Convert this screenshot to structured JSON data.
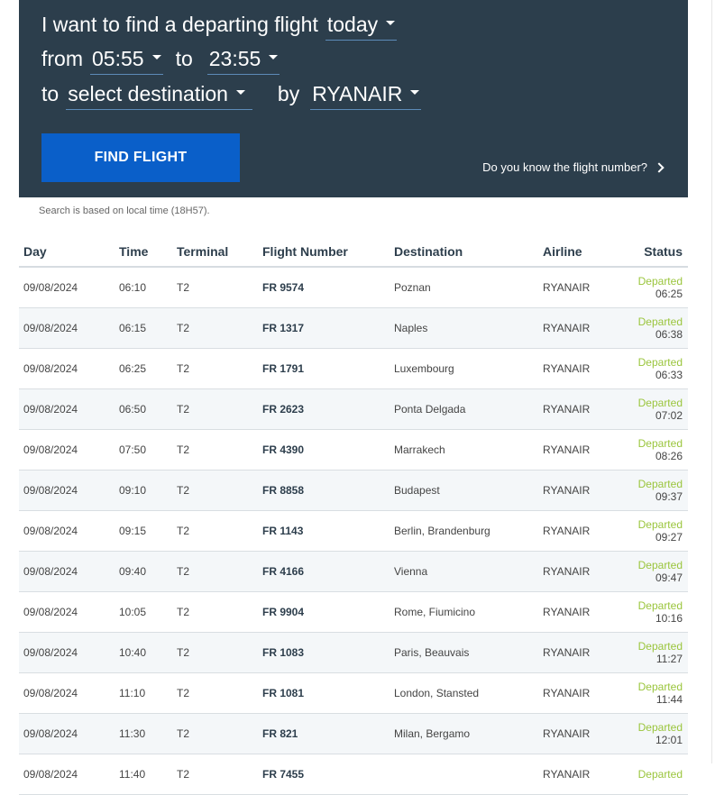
{
  "search": {
    "intro": "I want to find a departing flight",
    "date_value": "today",
    "from_word": "from",
    "from_time": "05:55",
    "to_word": "to",
    "to_time": "23:55",
    "dest_to_word": "to",
    "destination_value": "select destination",
    "by_word": "by",
    "airline_value": "RYANAIR",
    "find_button": "FIND FLIGHT",
    "flight_number_link": "Do you know the flight number?",
    "local_time_note": "Search is based on local time (18H57)."
  },
  "table": {
    "headers": [
      "Day",
      "Time",
      "Terminal",
      "Flight Number",
      "Destination",
      "Airline",
      "Status"
    ],
    "rows": [
      {
        "day": "09/08/2024",
        "time": "06:10",
        "terminal": "T2",
        "flight": "FR 9574",
        "destination": "Poznan",
        "airline": "RYANAIR",
        "status": "Departed",
        "status_time": "06:25"
      },
      {
        "day": "09/08/2024",
        "time": "06:15",
        "terminal": "T2",
        "flight": "FR 1317",
        "destination": "Naples",
        "airline": "RYANAIR",
        "status": "Departed",
        "status_time": "06:38"
      },
      {
        "day": "09/08/2024",
        "time": "06:25",
        "terminal": "T2",
        "flight": "FR 1791",
        "destination": "Luxembourg",
        "airline": "RYANAIR",
        "status": "Departed",
        "status_time": "06:33"
      },
      {
        "day": "09/08/2024",
        "time": "06:50",
        "terminal": "T2",
        "flight": "FR 2623",
        "destination": "Ponta Delgada",
        "airline": "RYANAIR",
        "status": "Departed",
        "status_time": "07:02"
      },
      {
        "day": "09/08/2024",
        "time": "07:50",
        "terminal": "T2",
        "flight": "FR 4390",
        "destination": "Marrakech",
        "airline": "RYANAIR",
        "status": "Departed",
        "status_time": "08:26"
      },
      {
        "day": "09/08/2024",
        "time": "09:10",
        "terminal": "T2",
        "flight": "FR 8858",
        "destination": "Budapest",
        "airline": "RYANAIR",
        "status": "Departed",
        "status_time": "09:37"
      },
      {
        "day": "09/08/2024",
        "time": "09:15",
        "terminal": "T2",
        "flight": "FR 1143",
        "destination": "Berlin, Brandenburg",
        "airline": "RYANAIR",
        "status": "Departed",
        "status_time": "09:27"
      },
      {
        "day": "09/08/2024",
        "time": "09:40",
        "terminal": "T2",
        "flight": "FR 4166",
        "destination": "Vienna",
        "airline": "RYANAIR",
        "status": "Departed",
        "status_time": "09:47"
      },
      {
        "day": "09/08/2024",
        "time": "10:05",
        "terminal": "T2",
        "flight": "FR 9904",
        "destination": "Rome, Fiumicino",
        "airline": "RYANAIR",
        "status": "Departed",
        "status_time": "10:16"
      },
      {
        "day": "09/08/2024",
        "time": "10:40",
        "terminal": "T2",
        "flight": "FR 1083",
        "destination": "Paris, Beauvais",
        "airline": "RYANAIR",
        "status": "Departed",
        "status_time": "11:27"
      },
      {
        "day": "09/08/2024",
        "time": "11:10",
        "terminal": "T2",
        "flight": "FR 1081",
        "destination": "London, Stansted",
        "airline": "RYANAIR",
        "status": "Departed",
        "status_time": "11:44"
      },
      {
        "day": "09/08/2024",
        "time": "11:30",
        "terminal": "T2",
        "flight": "FR 821",
        "destination": "Milan, Bergamo",
        "airline": "RYANAIR",
        "status": "Departed",
        "status_time": "12:01"
      },
      {
        "day": "09/08/2024",
        "time": "11:40",
        "terminal": "T2",
        "flight": "FR 7455",
        "destination": "",
        "airline": "RYANAIR",
        "status": "Departed",
        "status_time": ""
      }
    ]
  },
  "colors": {
    "panel_bg": "#2c3e4c",
    "button_bg": "#0a5fc9",
    "departed": "#9ac53c"
  }
}
